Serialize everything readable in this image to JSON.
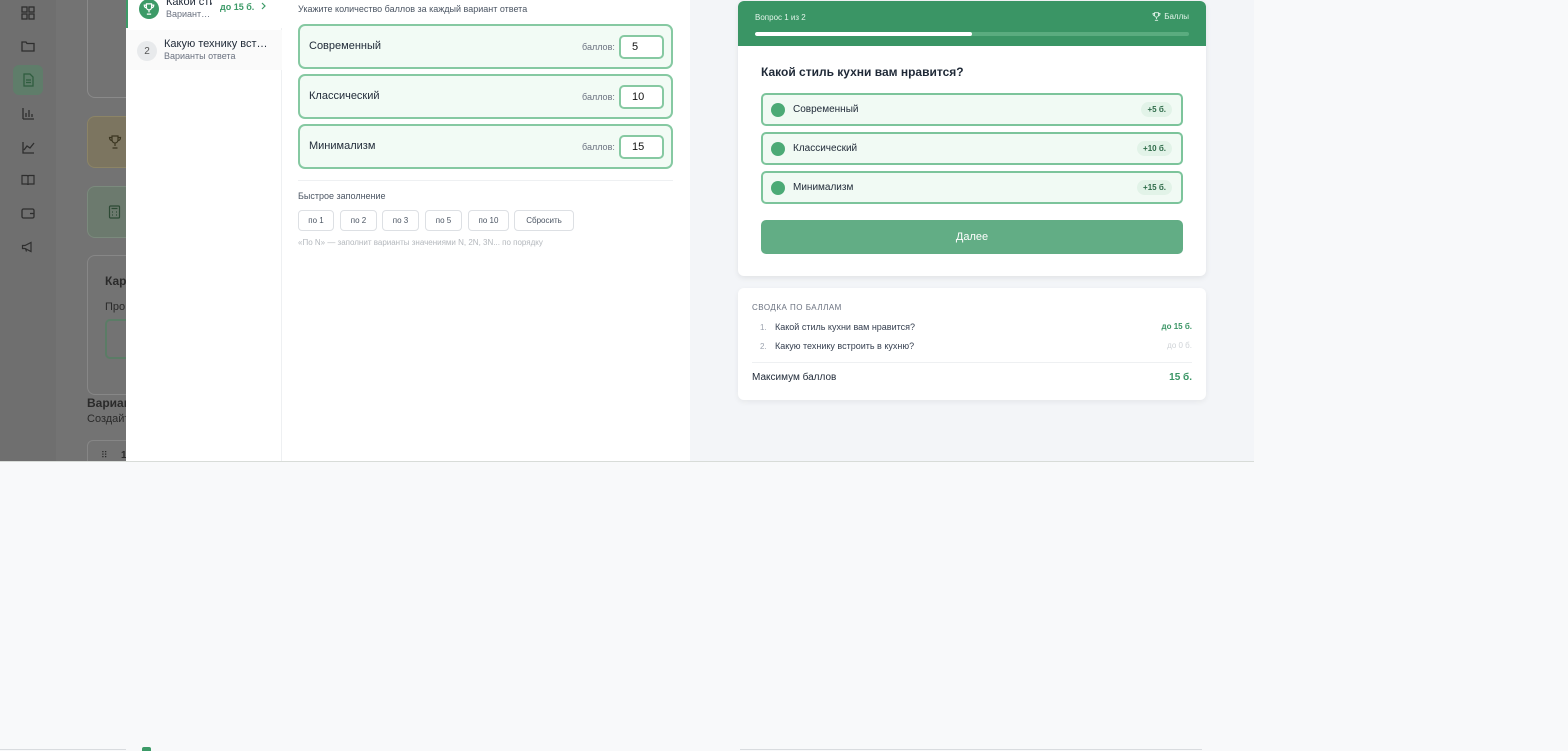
{
  "question_list": [
    {
      "title": "Какой стиль кухни вам нравится?",
      "subtitle": "Варианты ответа",
      "max": "до 15 б."
    },
    {
      "number": "2",
      "title": "Какую технику встроить в кухню?",
      "subtitle": "Варианты ответа"
    }
  ],
  "editor": {
    "instruction": "Укажите количество баллов за каждый вариант ответа",
    "points_label": "баллов:",
    "options": [
      {
        "label": "Современный",
        "points": "5"
      },
      {
        "label": "Классический",
        "points": "10"
      },
      {
        "label": "Минимализм",
        "points": "15"
      }
    ],
    "quick_fill": {
      "title": "Быстрое заполнение",
      "buttons": [
        "по 1",
        "по 2",
        "по 3",
        "по 5",
        "по 10",
        "Сбросить"
      ],
      "hint": "«По N» — заполнит варианты значениями N, 2N, 3N... по порядку"
    }
  },
  "preview": {
    "counter": "Вопрос 1 из 2",
    "scores_label": "Баллы",
    "progress_fraction": 0.5,
    "question": "Какой стиль кухни вам нравится?",
    "options": [
      {
        "label": "Современный",
        "badge": "+5 б."
      },
      {
        "label": "Классический",
        "badge": "+10 б."
      },
      {
        "label": "Минимализм",
        "badge": "+15 б."
      }
    ],
    "next_button": "Далее"
  },
  "summary": {
    "title": "СВОДКА ПО БАЛЛАМ",
    "rows": [
      {
        "num": "1.",
        "question": "Какой стиль кухни вам нравится?",
        "value": "до 15 б."
      },
      {
        "num": "2.",
        "question": "Какую технику встроить в кухню?",
        "value": "до 0 б."
      }
    ],
    "total_label": "Максимум баллов",
    "total_value": "15 б."
  },
  "background_app": {
    "card_title": "Кар",
    "card_text": "Про",
    "section_title": "Вариан",
    "section_subtitle": "Создайт",
    "row_number": "1"
  },
  "colors": {
    "accent": "#3a9565",
    "option_border": "#86c9a2",
    "option_bg": "#f2fbf5"
  }
}
